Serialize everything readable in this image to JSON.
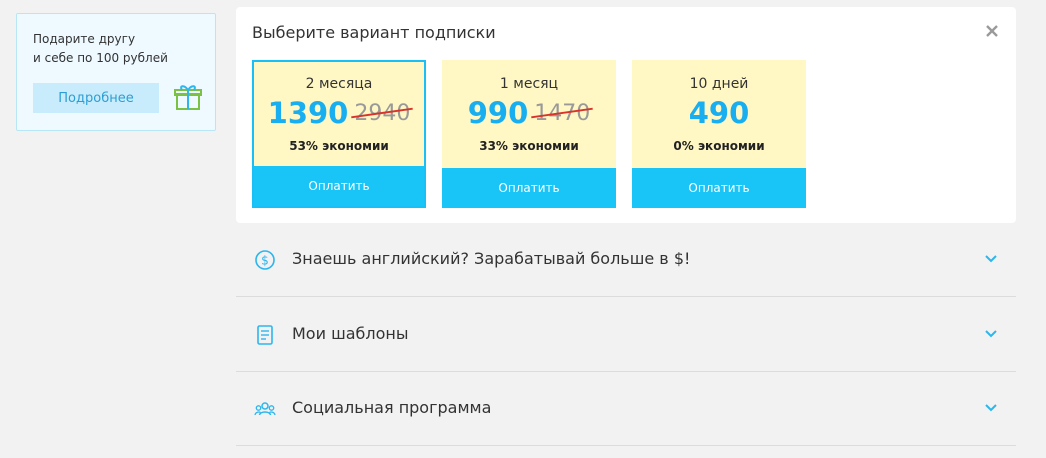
{
  "promo": {
    "line1": "Подарите другу",
    "line2": "и себе по 100 рублей",
    "button_label": "Подробнее",
    "gift_icon": "gift-icon"
  },
  "subscription": {
    "title": "Выберите вариант подписки",
    "close_icon": "close-icon",
    "plans": [
      {
        "period": "2 месяца",
        "price": "1390",
        "old_price": "2940",
        "saving": "53% экономии",
        "button": "Оплатить",
        "selected": true
      },
      {
        "period": "1 месяц",
        "price": "990",
        "old_price": "1470",
        "saving": "33% экономии",
        "button": "Оплатить",
        "selected": false
      },
      {
        "period": "10 дней",
        "price": "490",
        "old_price": "",
        "saving": "0% экономии",
        "button": "Оплатить",
        "selected": false
      }
    ]
  },
  "accordion": {
    "items": [
      {
        "label": "Знаешь английский? Зарабатывай больше в $!",
        "icon": "dollar-icon"
      },
      {
        "label": "Мои шаблоны",
        "icon": "document-icon"
      },
      {
        "label": "Социальная программа",
        "icon": "people-icon"
      }
    ]
  },
  "colors": {
    "accent": "#19c4f7",
    "price": "#19aef0",
    "plan_bg": "#fff8c4",
    "strike": "#d9342b",
    "page_bg": "#f2f2f2"
  }
}
